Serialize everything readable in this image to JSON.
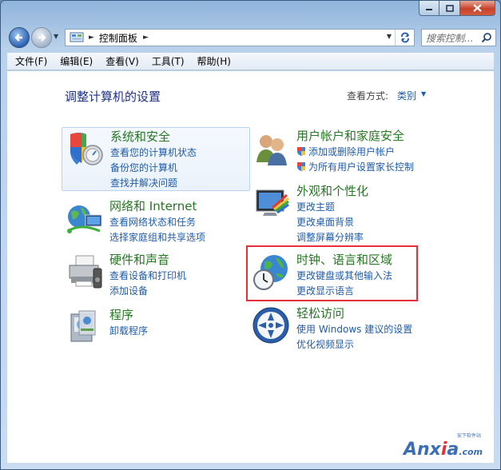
{
  "nav": {
    "breadcrumb": "控制面板",
    "search_placeholder": "搜索控制..."
  },
  "menu": {
    "file": "文件(F)",
    "edit": "编辑(E)",
    "view": "查看(V)",
    "tools": "工具(T)",
    "help": "帮助(H)"
  },
  "page": {
    "title": "调整计算机的设置",
    "view_by_label": "查看方式:",
    "view_by_value": "类别"
  },
  "categories": {
    "system": {
      "title": "系统和安全",
      "links": [
        "查看您的计算机状态",
        "备份您的计算机",
        "查找并解决问题"
      ]
    },
    "network": {
      "title": "网络和 Internet",
      "links": [
        "查看网络状态和任务",
        "选择家庭组和共享选项"
      ]
    },
    "hardware": {
      "title": "硬件和声音",
      "links": [
        "查看设备和打印机",
        "添加设备"
      ]
    },
    "programs": {
      "title": "程序",
      "links": [
        "卸载程序"
      ]
    },
    "users": {
      "title": "用户帐户和家庭安全",
      "links": [
        "添加或删除用户帐户",
        "为所有用户设置家长控制"
      ]
    },
    "appearance": {
      "title": "外观和个性化",
      "links": [
        "更改主题",
        "更改桌面背景",
        "调整屏幕分辨率"
      ]
    },
    "clock": {
      "title": "时钟、语言和区域",
      "links": [
        "更改键盘或其他输入法",
        "更改显示语言"
      ]
    },
    "ease": {
      "title": "轻松访问",
      "links": [
        "使用 Windows 建议的设置",
        "优化视频显示"
      ]
    }
  },
  "watermark": {
    "brand_pre": "Anx",
    "brand_dot": "i",
    "brand_post": "a",
    "brand_suffix": ".com",
    "small": "安下软件站"
  },
  "colors": {
    "category_title": "#267723",
    "link": "#1f5ca8",
    "page_title": "#1e3287",
    "highlight_border": "#e5303c"
  }
}
